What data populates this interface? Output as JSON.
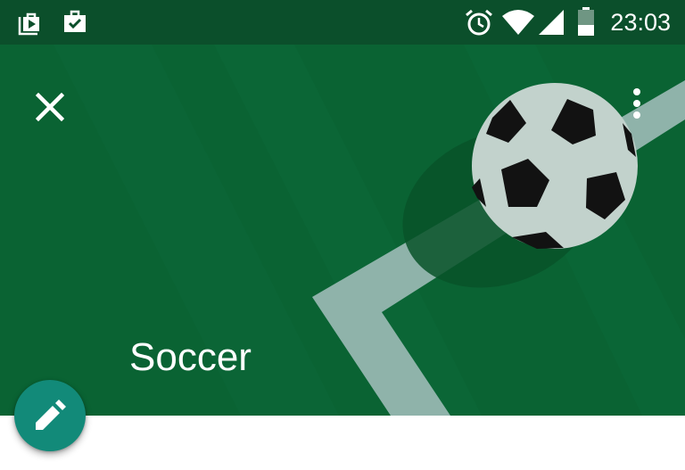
{
  "status_bar": {
    "time": "23:03",
    "icons": [
      "play-store-icon",
      "work-briefcase-icon",
      "alarm-icon",
      "wifi-icon",
      "cellular-signal-icon",
      "battery-icon"
    ]
  },
  "header": {
    "title": "Soccer",
    "close_icon": "close-icon",
    "menu_icon": "more-vert-icon"
  },
  "fab": {
    "icon": "edit-pencil-icon"
  },
  "colors": {
    "status_bar": "#0b4f2b",
    "field": "#0a6333",
    "field_line": "#8fb3aa",
    "fab": "#128a79"
  }
}
